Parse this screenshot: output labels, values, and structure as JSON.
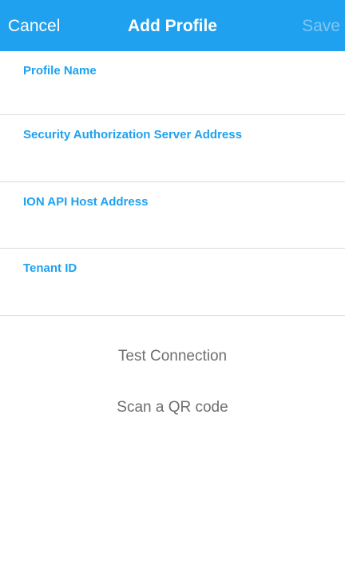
{
  "nav": {
    "cancel_label": "Cancel",
    "title": "Add Profile",
    "save_label": "Save"
  },
  "form": {
    "fields": [
      {
        "label": "Profile Name",
        "value": ""
      },
      {
        "label": "Security Authorization Server Address",
        "value": ""
      },
      {
        "label": "ION API Host Address",
        "value": ""
      },
      {
        "label": "Tenant ID",
        "value": ""
      }
    ]
  },
  "actions": {
    "test_connection": "Test Connection",
    "scan_qr": "Scan a QR code"
  },
  "colors": {
    "accent": "#1fa1ef",
    "save_disabled": "#7fc8f5",
    "action_text": "#6e6e6e",
    "divider": "#dcdcdc"
  }
}
